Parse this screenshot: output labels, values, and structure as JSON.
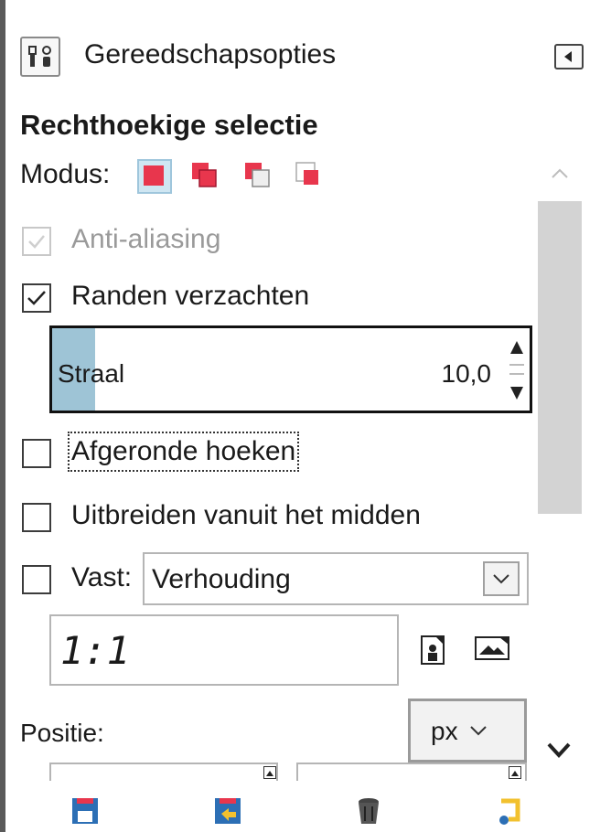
{
  "header": {
    "title": "Gereedschapsopties",
    "icon": "tool-options-icon",
    "menu_icon": "panel-menu-icon"
  },
  "tool": {
    "title": "Rechthoekige selectie"
  },
  "mode": {
    "label": "Modus:",
    "buttons": [
      {
        "name": "replace-mode",
        "active": true
      },
      {
        "name": "add-mode",
        "active": false
      },
      {
        "name": "subtract-mode",
        "active": false
      },
      {
        "name": "intersect-mode",
        "active": false
      }
    ],
    "accent": "#e8364d"
  },
  "options": {
    "antialias": {
      "label": "Anti-aliasing",
      "checked": true,
      "disabled": true
    },
    "feather": {
      "label": "Randen verzachten",
      "checked": true
    },
    "radius": {
      "label": "Straal",
      "value": "10,0",
      "fill_fraction": 0.09
    },
    "rounded": {
      "label": "Afgeronde hoeken",
      "checked": false
    },
    "expand": {
      "label": "Uitbreiden vanuit het midden",
      "checked": false
    },
    "fixed": {
      "label": "Vast:",
      "checked": false,
      "selected": "Verhouding"
    },
    "ratio": {
      "value": "1:1"
    }
  },
  "position": {
    "label": "Positie:",
    "unit": "px"
  },
  "footer": {
    "icons": [
      "save-preset-icon",
      "restore-preset-icon",
      "delete-preset-icon",
      "reset-icon"
    ]
  }
}
